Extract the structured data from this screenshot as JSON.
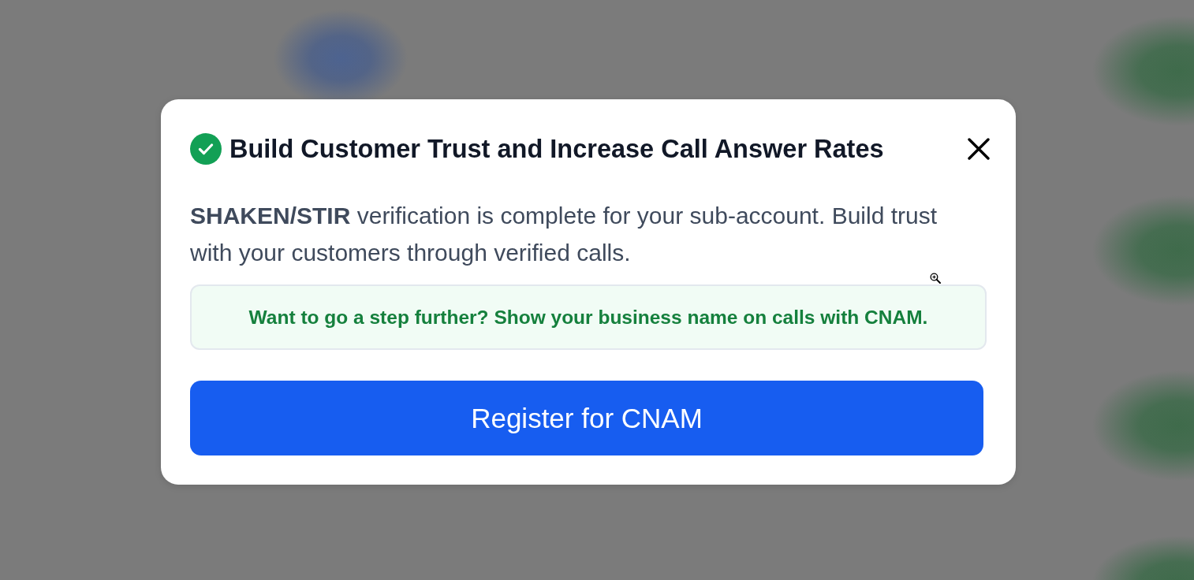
{
  "modal": {
    "title": "Build Customer Trust and Increase Call Answer Rates",
    "message": "**SHAKEN/STIR** verification is complete for your sub-account. Build trust with your customers through verified calls.",
    "callout": "Want to go a step further? Show your business name on calls with CNAM.",
    "button": "Register for CNAM"
  }
}
